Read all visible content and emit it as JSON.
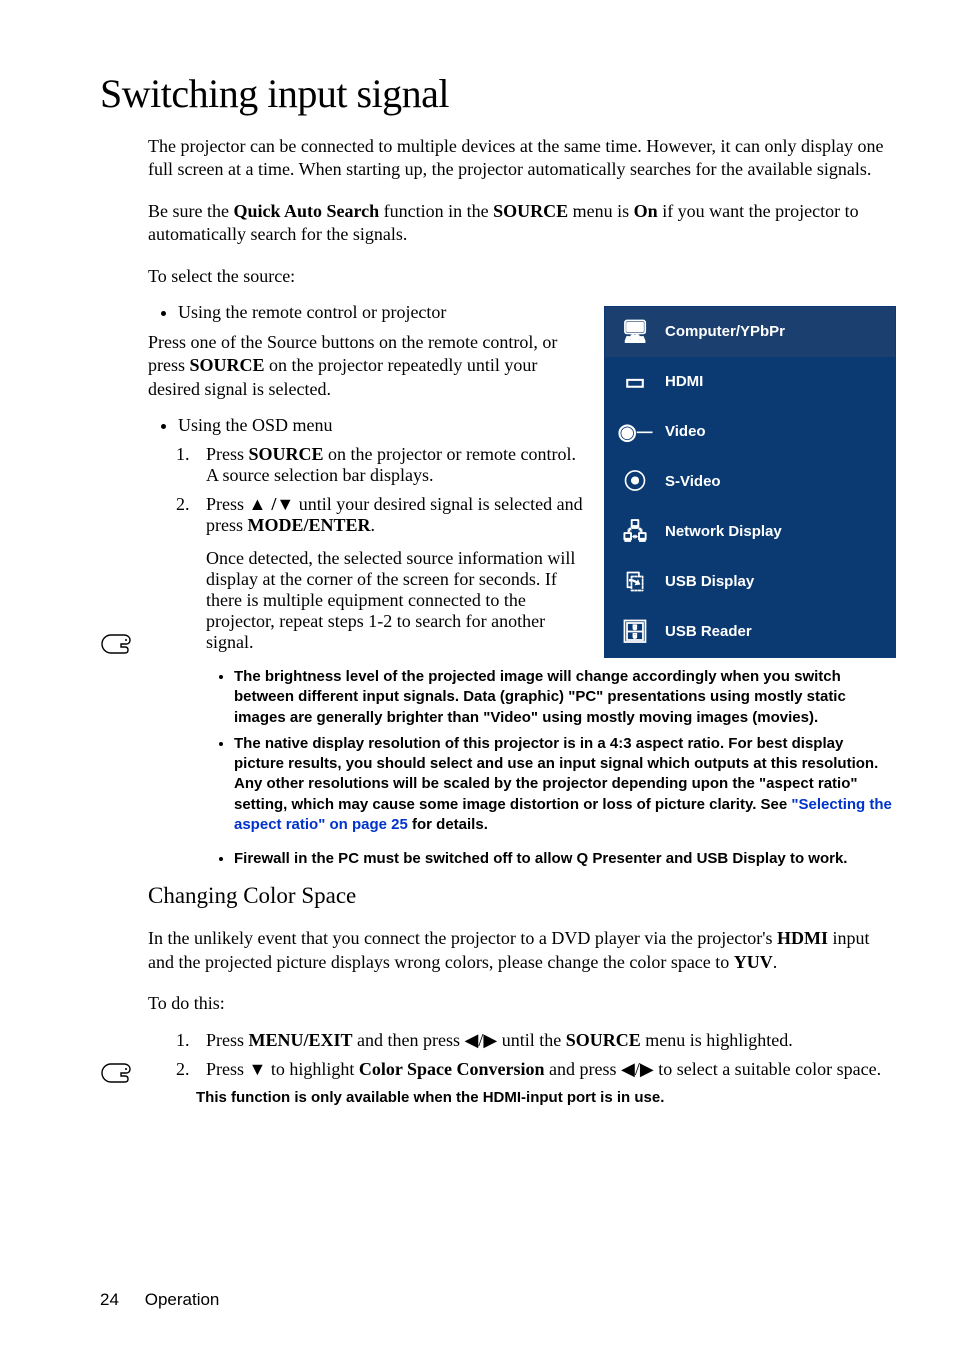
{
  "title": "Switching input signal",
  "intro1": "The projector can be connected to multiple devices at the same time. However, it can only display one full screen at a time. When starting up, the projector automatically searches for the available signals.",
  "intro2_pre": "Be sure the ",
  "intro2_b1": "Quick Auto Search",
  "intro2_mid": " function in the ",
  "intro2_b2": "SOURCE",
  "intro2_mid2": " menu is ",
  "intro2_b3": "On",
  "intro2_post": " if you want the projector to automatically search for the signals.",
  "to_select": "To select the source:",
  "bullet_remote": "Using the remote control or projector",
  "remote_para_pre": "Press one of the Source buttons on the remote control, or press ",
  "remote_para_b1": "SOURCE",
  "remote_para_post": " on the projector repeatedly until your desired signal is selected.",
  "bullet_osd": "Using the OSD menu",
  "step1_pre": "Press ",
  "step1_b1": "SOURCE",
  "step1_post": " on the projector or remote control. A source selection bar displays.",
  "step2_pre": "Press ",
  "step2_mid": " until your desired signal is selected and press ",
  "step2_b1": "MODE/ENTER",
  "step2_post": ".",
  "step2_detected": "Once detected, the selected source information will display at the corner of the screen for seconds. If there is multiple equipment connected to the projector, repeat steps 1-2 to search for another signal.",
  "notes": {
    "n1": "The brightness level of the projected image will change accordingly when you switch between different input signals. Data (graphic) \"PC\" presentations using mostly static images are generally brighter than \"Video\" using mostly moving images (movies).",
    "n2_a": "The native display resolution of this projector is in a 4:3 aspect ratio. For best display picture results, you should select and use an input signal which outputs at this resolution. Any other resolutions will be scaled by the projector depending upon the \"aspect ratio\" setting, which may cause some image distortion or loss of picture clarity. See ",
    "n2_link": "\"Selecting the aspect ratio\" on page 25",
    "n2_b": " for details.",
    "n3": "Firewall in the PC must be switched off to allow Q Presenter and USB Display to work."
  },
  "changing_header": "Changing Color Space",
  "ccs_para_pre": "In the unlikely event that you connect the projector to a DVD player via the projector's ",
  "ccs_para_b1": "HDMI",
  "ccs_para_mid": " input and the projected picture displays wrong colors, please change the color space to ",
  "ccs_para_b2": "YUV",
  "ccs_para_post": ".",
  "to_do_this": "To do this:",
  "ccs_step1_pre": "Press ",
  "ccs_step1_b1": "MENU/EXIT",
  "ccs_step1_mid": " and then press ",
  "ccs_step1_mid2": " until the ",
  "ccs_step1_b2": "SOURCE",
  "ccs_step1_post": " menu is highlighted.",
  "ccs_step2_pre": "Press ",
  "ccs_step2_mid": " to highlight ",
  "ccs_step2_b1": "Color Space Conversion",
  "ccs_step2_mid2": " and press ",
  "ccs_step2_post": " to select a suitable color space.",
  "final_note": "This function is only available when the HDMI-input port is in use.",
  "footer_page": "24",
  "footer_label": "Operation",
  "source_panel": {
    "items": [
      {
        "icon": "computer-icon",
        "glyph": "🖥",
        "label": "Computer/YPbPr"
      },
      {
        "icon": "hdmi-icon",
        "glyph": "▭",
        "label": "HDMI"
      },
      {
        "icon": "video-icon",
        "glyph": "◉─",
        "label": "Video"
      },
      {
        "icon": "svideo-icon",
        "glyph": "⦿",
        "label": "S-Video"
      },
      {
        "icon": "network-icon",
        "glyph": "🖧",
        "label": "Network Display"
      },
      {
        "icon": "usb-display-icon",
        "glyph": "⎘",
        "label": "USB Display"
      },
      {
        "icon": "usb-reader-icon",
        "glyph": "🗄",
        "label": "USB Reader"
      }
    ]
  }
}
